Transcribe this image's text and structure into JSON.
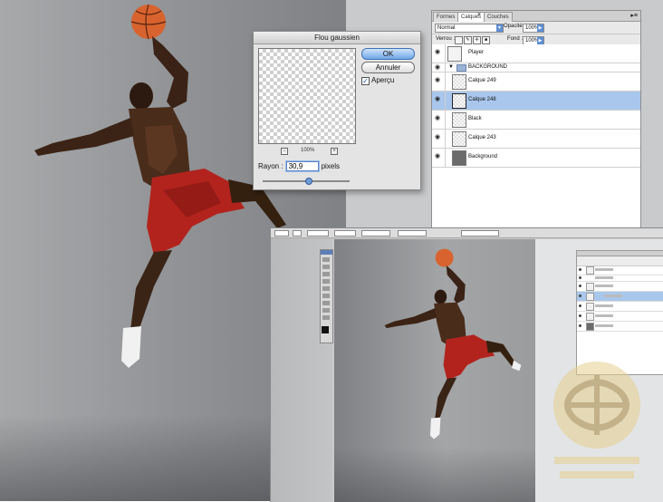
{
  "gaussian_dialog": {
    "title": "Flou gaussien",
    "ok_label": "OK",
    "cancel_label": "Annuler",
    "preview_label": "Aperçu",
    "preview_checked": true,
    "zoom_minus": "−",
    "zoom_level": "100%",
    "zoom_plus": "+",
    "radius_label": "Rayon :",
    "radius_value": "30,9",
    "radius_unit": "pixels"
  },
  "layers_panel": {
    "tabs": [
      "Formes",
      "Calques",
      "Couches"
    ],
    "tab_close": "×",
    "blend_mode": "Normal",
    "opacity_label": "Opacité",
    "opacity_value": "100%",
    "lock_label": "Verrou :",
    "fill_label": "Fond :",
    "fill_value": "100%",
    "layers": [
      {
        "name": "Player",
        "thumb": "figure",
        "selected": false
      },
      {
        "name": "BACKGROUND",
        "thumb": "folder",
        "selected": false
      },
      {
        "name": "Calque 249",
        "thumb": "transparent",
        "selected": false
      },
      {
        "name": "Calque 248",
        "thumb": "transparent",
        "selected": true
      },
      {
        "name": "Black",
        "thumb": "transparent",
        "selected": false
      },
      {
        "name": "Calque 243",
        "thumb": "transparent",
        "selected": false
      },
      {
        "name": "Background",
        "thumb": "dark",
        "selected": false
      }
    ]
  },
  "icons": {
    "visibility": "eye-icon",
    "folder": "folder-icon",
    "disclosure": "triangle-down-icon",
    "checkbox": "checkmark-icon",
    "panel_menu": "panel-menu-icon"
  },
  "colors": {
    "selection_highlight": "#a9c7ec",
    "ok_button": "#6fa7e8",
    "shorts_red": "#b3231d"
  }
}
